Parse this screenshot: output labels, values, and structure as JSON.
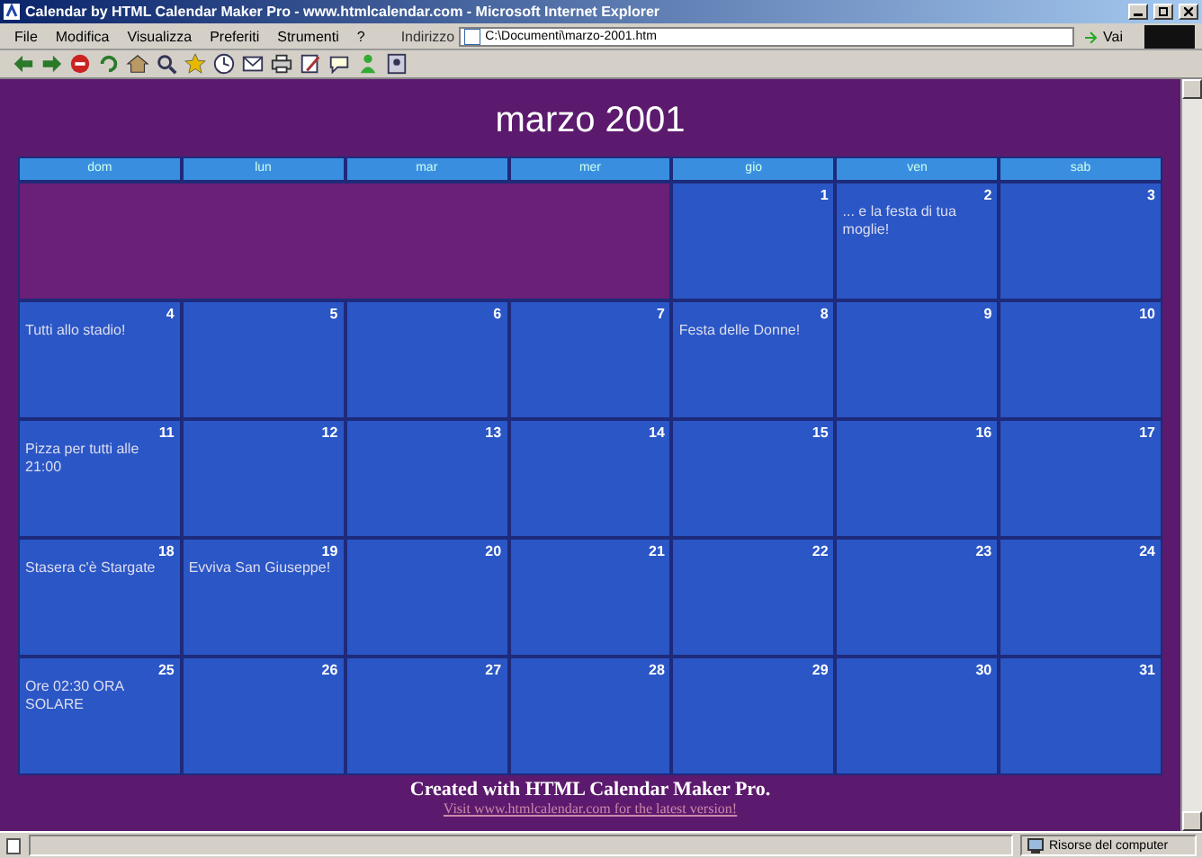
{
  "window": {
    "title": "Calendar by HTML Calendar Maker Pro - www.htmlcalendar.com - Microsoft Internet Explorer"
  },
  "menu": [
    "File",
    "Modifica",
    "Visualizza",
    "Preferiti",
    "Strumenti",
    "?"
  ],
  "address": {
    "label": "Indirizzo",
    "value": "C:\\Documenti\\marzo-2001.htm",
    "go": "Vai"
  },
  "calendar": {
    "title": "marzo 2001",
    "weekdays": [
      "dom",
      "lun",
      "mar",
      "mer",
      "gio",
      "ven",
      "sab"
    ],
    "weeks": [
      [
        {
          "kind": "blank"
        },
        {
          "kind": "blank"
        },
        {
          "kind": "blank"
        },
        {
          "kind": "blank"
        },
        {
          "kind": "day",
          "day": "1"
        },
        {
          "kind": "day",
          "day": "2",
          "event": "... e la festa di tua moglie!"
        },
        {
          "kind": "day",
          "day": "3"
        }
      ],
      [
        {
          "kind": "day",
          "day": "4",
          "event": "Tutti allo stadio!"
        },
        {
          "kind": "day",
          "day": "5"
        },
        {
          "kind": "day",
          "day": "6"
        },
        {
          "kind": "day",
          "day": "7"
        },
        {
          "kind": "day",
          "day": "8",
          "event": "Festa delle Donne!"
        },
        {
          "kind": "day",
          "day": "9"
        },
        {
          "kind": "day",
          "day": "10"
        }
      ],
      [
        {
          "kind": "day",
          "day": "11",
          "event": "Pizza per tutti alle 21:00"
        },
        {
          "kind": "day",
          "day": "12"
        },
        {
          "kind": "day",
          "day": "13"
        },
        {
          "kind": "day",
          "day": "14"
        },
        {
          "kind": "day",
          "day": "15"
        },
        {
          "kind": "day",
          "day": "16"
        },
        {
          "kind": "day",
          "day": "17"
        }
      ],
      [
        {
          "kind": "day",
          "day": "18",
          "event": "Stasera c'è Stargate"
        },
        {
          "kind": "day",
          "day": "19",
          "event": "Evviva San Giuseppe!"
        },
        {
          "kind": "day",
          "day": "20"
        },
        {
          "kind": "day",
          "day": "21"
        },
        {
          "kind": "day",
          "day": "22"
        },
        {
          "kind": "day",
          "day": "23"
        },
        {
          "kind": "day",
          "day": "24"
        }
      ],
      [
        {
          "kind": "day",
          "day": "25",
          "event": "Ore 02:30 ORA SOLARE"
        },
        {
          "kind": "day",
          "day": "26"
        },
        {
          "kind": "day",
          "day": "27"
        },
        {
          "kind": "day",
          "day": "28"
        },
        {
          "kind": "day",
          "day": "29"
        },
        {
          "kind": "day",
          "day": "30"
        },
        {
          "kind": "day",
          "day": "31"
        }
      ]
    ],
    "footer": "Created with HTML Calendar Maker Pro.",
    "footer_link": "Visit www.htmlcalendar.com for the latest version!"
  },
  "status_bar": {
    "zone": "Risorse del computer"
  }
}
